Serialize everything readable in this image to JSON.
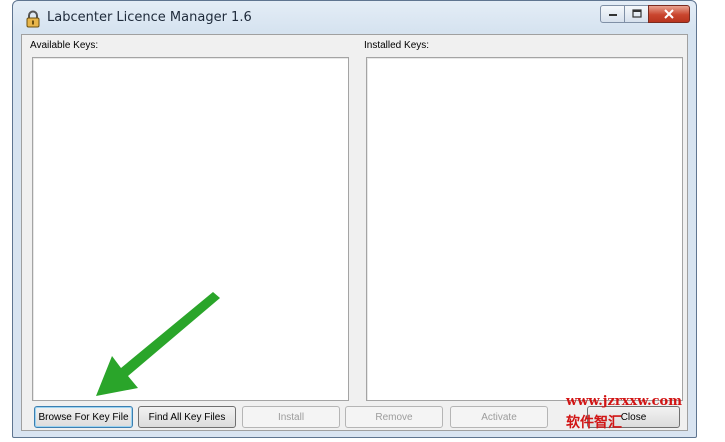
{
  "window": {
    "title": "Labcenter Licence Manager 1.6",
    "icon": "lock-icon"
  },
  "panels": {
    "available_label": "Available Keys:",
    "installed_label": "Installed Keys:"
  },
  "buttons": {
    "browse": "Browse For Key File",
    "find_all": "Find All Key Files",
    "install": "Install",
    "remove": "Remove",
    "activate": "Activate",
    "close": "Close"
  },
  "watermark": {
    "url": "www.jzrxxw.com",
    "text_cn": "软件智汇"
  },
  "colors": {
    "arrow": "#2aa52a",
    "watermark": "#d11414",
    "close_button": "#c9452e"
  }
}
